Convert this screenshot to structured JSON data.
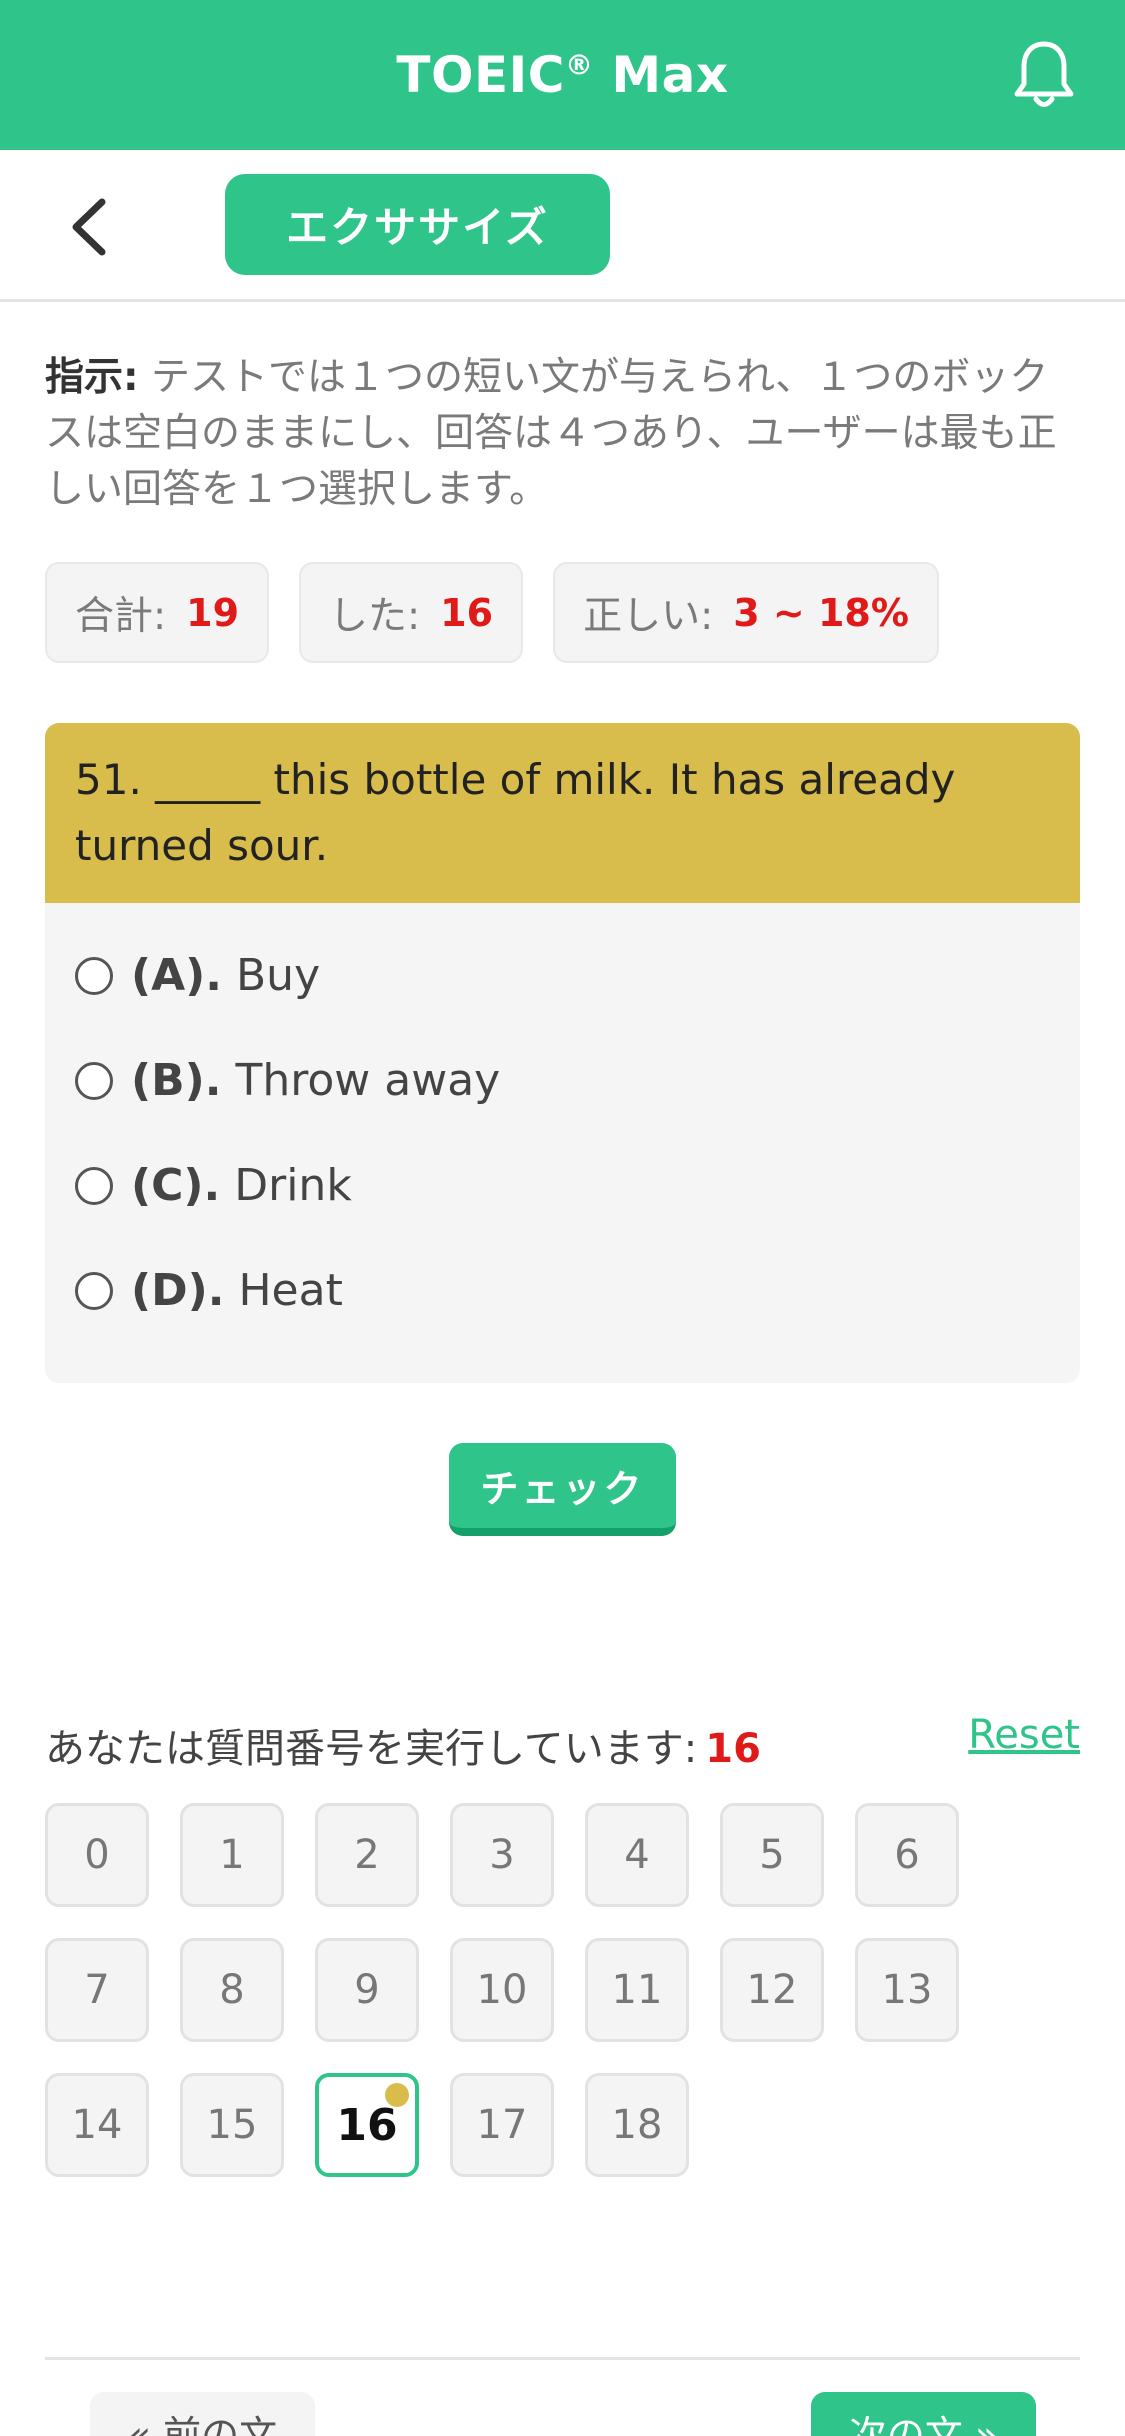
{
  "header": {
    "title": "TOEIC",
    "title_reg": "®",
    "title_suffix": " Max",
    "bell_icon": "bell-icon"
  },
  "subbar": {
    "back_icon": "chevron-left-icon",
    "tab_label": "エクササイズ"
  },
  "instructions": {
    "label": "指示:",
    "text": " テストでは１つの短い文が与えられ、１つのボックスは空白のままにし、回答は４つあり、ユーザーは最も正しい回答を１つ選択します。"
  },
  "stats": {
    "total_label": "合計:",
    "total_value": "19",
    "done_label": "した:",
    "done_value": "16",
    "correct_label": "正しい:",
    "correct_value": "3 ~ 18%"
  },
  "question": {
    "text": "51. _____ this bottle of milk. It has already turned sour.",
    "options": [
      {
        "key": "(A).",
        "text": "Buy"
      },
      {
        "key": "(B).",
        "text": "Throw away"
      },
      {
        "key": "(C).",
        "text": "Drink"
      },
      {
        "key": "(D).",
        "text": "Heat"
      }
    ]
  },
  "check_label": "チェック",
  "progress": {
    "running_label": "あなたは質問番号を実行しています:",
    "current": "16",
    "reset_label": "Reset",
    "numbers": [
      "0",
      "1",
      "2",
      "3",
      "4",
      "5",
      "6",
      "7",
      "8",
      "9",
      "10",
      "11",
      "12",
      "13",
      "14",
      "15",
      "16",
      "17",
      "18"
    ]
  },
  "nav": {
    "prev_label": "« 前の文",
    "next_label": "次の文 »"
  },
  "colors": {
    "brand": "#2ec48a",
    "question_header": "#d9bd4c",
    "highlight": "#e01919"
  }
}
